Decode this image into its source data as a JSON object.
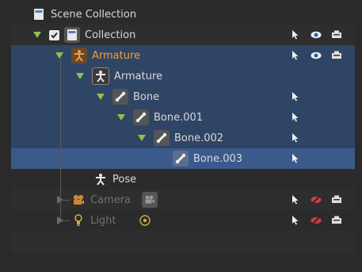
{
  "outliner": {
    "rows": [
      {
        "label": "Scene Collection",
        "icon": "scene-collection-icon"
      },
      {
        "label": "Collection",
        "icon": "collection-icon"
      },
      {
        "label": "Armature",
        "icon": "armature-object-icon",
        "color": "#f0a040"
      },
      {
        "label": "Armature",
        "icon": "armature-data-icon"
      },
      {
        "label": "Bone",
        "icon": "bone-icon"
      },
      {
        "label": "Bone.001",
        "icon": "bone-icon"
      },
      {
        "label": "Bone.002",
        "icon": "bone-icon"
      },
      {
        "label": "Bone.003",
        "icon": "bone-icon"
      },
      {
        "label": "Pose",
        "icon": "pose-icon"
      },
      {
        "label": "Camera",
        "icon": "camera-icon"
      },
      {
        "label": "Light",
        "icon": "light-icon"
      }
    ]
  },
  "colors": {
    "selected_row": "#2f4565",
    "active_row": "#3a5a8c",
    "expand_arrow": "#8bc34a",
    "armature_orange": "#f0a040",
    "hidden_eye": "#d43c3c"
  }
}
